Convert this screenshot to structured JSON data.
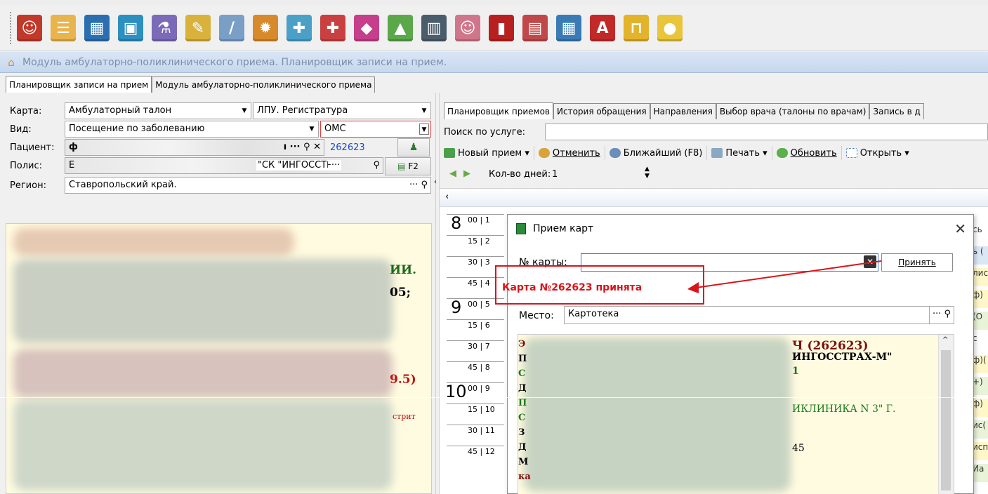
{
  "toolbar": {
    "icons": [
      {
        "name": "doctor-icon",
        "color": "#c0392b",
        "glyph": "☺"
      },
      {
        "name": "notepad-icon",
        "color": "#e9b44c",
        "glyph": "☰"
      },
      {
        "name": "calculator-icon",
        "color": "#2b6fb0",
        "glyph": "▦"
      },
      {
        "name": "id-card-icon",
        "color": "#2b8fc0",
        "glyph": "▣"
      },
      {
        "name": "lab-icon",
        "color": "#7b6ab8",
        "glyph": "⚗"
      },
      {
        "name": "edit-document-icon",
        "color": "#d9b23b",
        "glyph": "✎"
      },
      {
        "name": "syringe-icon",
        "color": "#7a9fc7",
        "glyph": "/"
      },
      {
        "name": "settings-panel-icon",
        "color": "#d68a2b",
        "glyph": "✹"
      },
      {
        "name": "medicine-icon",
        "color": "#4aa0c7",
        "glyph": "✚"
      },
      {
        "name": "first-aid-icon",
        "color": "#c84040",
        "glyph": "✚"
      },
      {
        "name": "basket-icon",
        "color": "#c53f8a",
        "glyph": "◆"
      },
      {
        "name": "shapes-icon",
        "color": "#5aa84a",
        "glyph": "▲"
      },
      {
        "name": "barcode-scanner-icon",
        "color": "#4b5c6b",
        "glyph": "▥"
      },
      {
        "name": "nurse-icon",
        "color": "#d0768a",
        "glyph": "☺"
      },
      {
        "name": "red-book-icon",
        "color": "#b82020",
        "glyph": "▮"
      },
      {
        "name": "calendar-window-icon",
        "color": "#c0484a",
        "glyph": "▤"
      },
      {
        "name": "schedule-icon",
        "color": "#3a7bb5",
        "glyph": "▦"
      },
      {
        "name": "pdf-icon",
        "color": "#c22a2a",
        "glyph": "A"
      },
      {
        "name": "lock-icon",
        "color": "#e2b32b",
        "glyph": "⊓"
      },
      {
        "name": "speech-bubble-icon",
        "color": "#e8c53a",
        "glyph": "●"
      }
    ]
  },
  "window": {
    "title": "Модуль амбулаторно-поликлинического приема. Планировщик записи на прием."
  },
  "module_tabs": [
    {
      "label": "Планировщик записи на прием",
      "active": true
    },
    {
      "label": "Модуль амбулаторно-поликлинического приема",
      "active": false
    }
  ],
  "left": {
    "karta_label": "Карта:",
    "karta_value": "Амбулаторный талон",
    "lpu_value": "ЛПУ. Регистратура",
    "vid_label": "Вид:",
    "vid_value": "Посещение по заболеванию",
    "oms_value": "ОМС",
    "patient_label": "Пациент:",
    "patient_value": "ф",
    "patient_tail": "ı ··· ",
    "patient_id": "262623",
    "polis_label": "Полис:",
    "polis_value": "Е",
    "polis_company": "\"СК \"ИНГОССТ⊦···",
    "f2_label": "F2",
    "region_label": "Регион:",
    "region_value": "Ставропольский край.",
    "info_fragments": [
      "ИИ.",
      "05;",
      "9.5)",
      "стрит"
    ]
  },
  "right": {
    "tabs": [
      {
        "label": "Планировщик приемов",
        "active": true
      },
      {
        "label": "История обращения",
        "active": false
      },
      {
        "label": "Направления",
        "active": false
      },
      {
        "label": "Выбор врача (талоны по врачам)",
        "active": false
      },
      {
        "label": "Запись в д",
        "active": false
      }
    ],
    "search_label": "Поиск по услуге:",
    "toolbar": {
      "new": "Новый прием ▾",
      "cancel": "Отменить",
      "nearest": "Ближайший (F8)",
      "print": "Печать ▾",
      "refresh": "Обновить",
      "open": "Открыть ▾"
    },
    "days_label": "Кол-во дней:",
    "days_value": "1",
    "schedule": [
      {
        "hour": "8",
        "min": "00",
        "slot": "1"
      },
      {
        "hour": "",
        "min": "15",
        "slot": "2"
      },
      {
        "hour": "",
        "min": "30",
        "slot": "3"
      },
      {
        "hour": "",
        "min": "45",
        "slot": "4"
      },
      {
        "hour": "9",
        "min": "00",
        "slot": "5"
      },
      {
        "hour": "",
        "min": "15",
        "slot": "6"
      },
      {
        "hour": "",
        "min": "30",
        "slot": "7"
      },
      {
        "hour": "",
        "min": "45",
        "slot": "8"
      },
      {
        "hour": "10",
        "min": "00",
        "slot": "9"
      },
      {
        "hour": "",
        "min": "15",
        "slot": "10"
      },
      {
        "hour": "",
        "min": "30",
        "slot": "11"
      },
      {
        "hour": "",
        "min": "45",
        "slot": "12"
      }
    ],
    "edge_fragments": [
      "сь",
      "ь (",
      "лис",
      "ф)",
      "(О",
      "с",
      "ф)(",
      "+)",
      "ф)",
      "ис(",
      "исп",
      "Иа"
    ]
  },
  "dialog": {
    "title": "Прием карт",
    "card_label": "№ карты:",
    "card_value": "",
    "accept_label": "Принять",
    "status": "Карта №262623 принята",
    "place_label": "Место:",
    "place_value": "Картотека",
    "info_lines": [
      {
        "text": "Ч (262623)",
        "color": "#7a1010"
      },
      {
        "text": "ИНГОССТРАХ-М\"",
        "color": "#000000"
      },
      {
        "text": "1",
        "color": "#1a7a1a"
      },
      {
        "text": "ИКЛИНИКА N 3\" Г.",
        "color": "#1a7a1a"
      },
      {
        "text": "45",
        "color": "#000000"
      }
    ],
    "left_letters": [
      "Э",
      "П",
      "С",
      "Д",
      "П",
      "С",
      "З",
      "Д",
      "М",
      "ка"
    ]
  },
  "colors": {
    "status_red": "#d9141a",
    "link_blue": "#1a49c9",
    "highlight_border": "#d9141a"
  }
}
